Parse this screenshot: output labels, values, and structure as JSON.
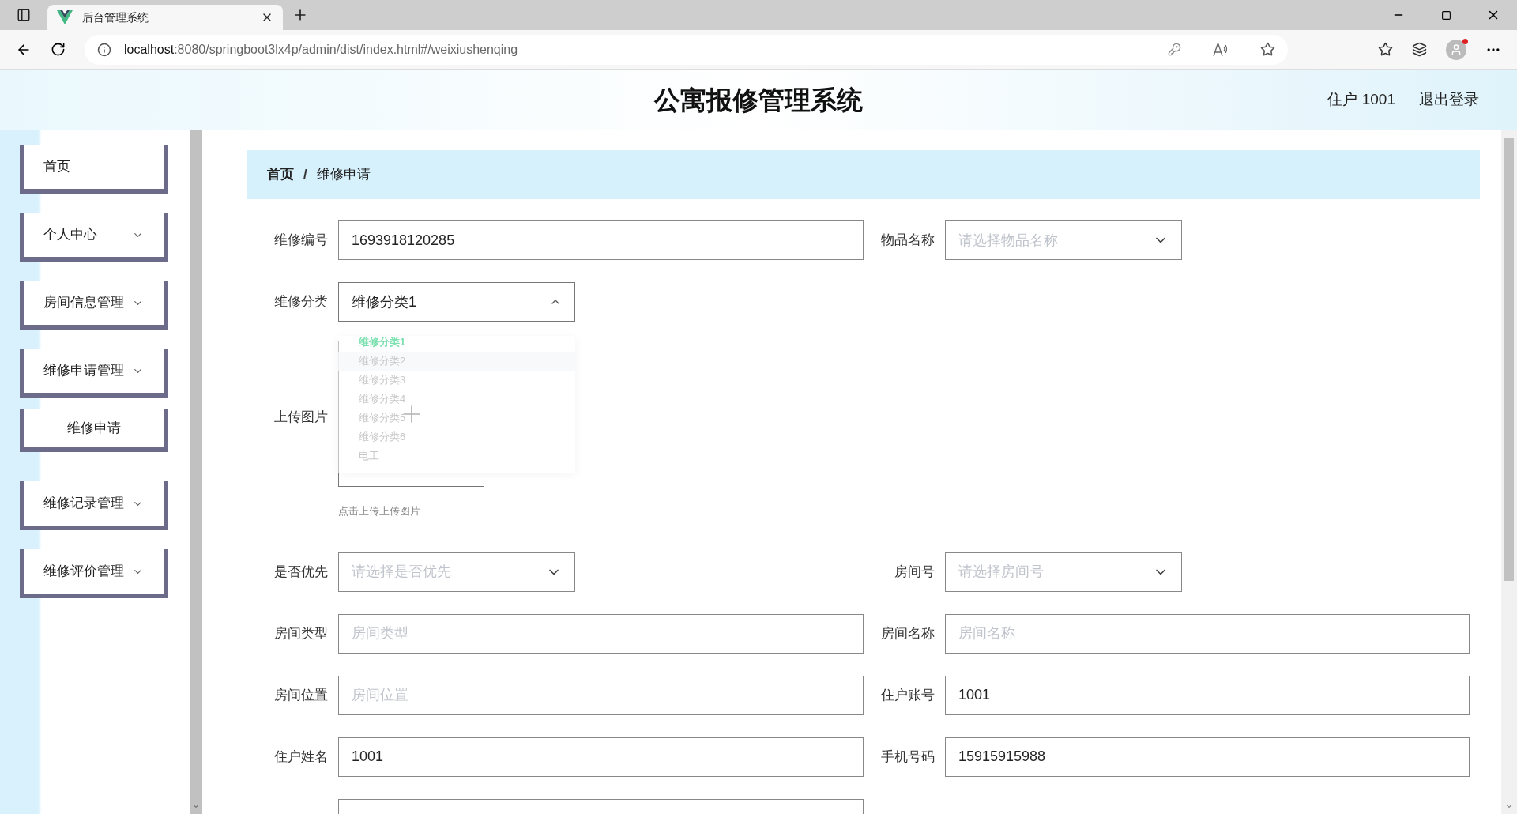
{
  "browser": {
    "tab_title": "后台管理系统",
    "url_host": "localhost",
    "url_path": ":8080/springboot3lx4p/admin/dist/index.html#/weixiushenqing"
  },
  "header": {
    "title": "公寓报修管理系统",
    "user": "住户 1001",
    "logout": "退出登录"
  },
  "sidebar": {
    "items": [
      {
        "label": "首页",
        "kind": "menu",
        "expandable": false
      },
      {
        "label": "个人中心",
        "kind": "menu",
        "expandable": true
      },
      {
        "label": "房间信息管理",
        "kind": "menu",
        "expandable": true
      },
      {
        "label": "维修申请管理",
        "kind": "menu",
        "expandable": true
      },
      {
        "label": "维修申请",
        "kind": "submenu",
        "expandable": false
      },
      {
        "label": "维修记录管理",
        "kind": "menu",
        "expandable": true
      },
      {
        "label": "维修评价管理",
        "kind": "menu",
        "expandable": true
      }
    ]
  },
  "breadcrumb": {
    "items": [
      "首页",
      "维修申请"
    ],
    "separator": "/"
  },
  "form": {
    "rows": [
      {
        "fields": [
          {
            "label": "维修编号",
            "kind": "input",
            "value": "1693918120285"
          },
          {
            "label": "物品名称",
            "kind": "select",
            "placeholder": "请选择物品名称",
            "open": false
          }
        ]
      },
      {
        "fields": [
          {
            "label": "维修分类",
            "kind": "select",
            "value": "维修分类1",
            "open": true,
            "options": [
              {
                "label": "维修分类1",
                "selected": true,
                "hovered": false
              },
              {
                "label": "维修分类2",
                "selected": false,
                "hovered": true
              },
              {
                "label": "维修分类3",
                "selected": false,
                "hovered": false
              },
              {
                "label": "维修分类4",
                "selected": false,
                "hovered": false
              },
              {
                "label": "维修分类5",
                "selected": false,
                "hovered": false
              },
              {
                "label": "维修分类6",
                "selected": false,
                "hovered": false
              },
              {
                "label": "电工",
                "selected": false,
                "hovered": false
              }
            ]
          }
        ]
      },
      {
        "fields": [
          {
            "label": "上传图片",
            "kind": "upload",
            "hint": "点击上传上传图片"
          }
        ]
      },
      {
        "fields": [
          {
            "label": "是否优先",
            "kind": "select",
            "placeholder": "请选择是否优先",
            "open": false
          },
          {
            "label": "房间号",
            "kind": "select",
            "placeholder": "请选择房间号",
            "open": false
          }
        ]
      },
      {
        "fields": [
          {
            "label": "房间类型",
            "kind": "input",
            "placeholder": "房间类型"
          },
          {
            "label": "房间名称",
            "kind": "input",
            "placeholder": "房间名称"
          }
        ]
      },
      {
        "fields": [
          {
            "label": "房间位置",
            "kind": "input",
            "placeholder": "房间位置"
          },
          {
            "label": "住户账号",
            "kind": "input",
            "value": "1001"
          }
        ]
      },
      {
        "fields": [
          {
            "label": "住户姓名",
            "kind": "input",
            "value": "1001"
          },
          {
            "label": "手机号码",
            "kind": "input",
            "value": "15915915988"
          }
        ]
      },
      {
        "fields": [
          {
            "kind": "cut"
          }
        ]
      }
    ]
  }
}
